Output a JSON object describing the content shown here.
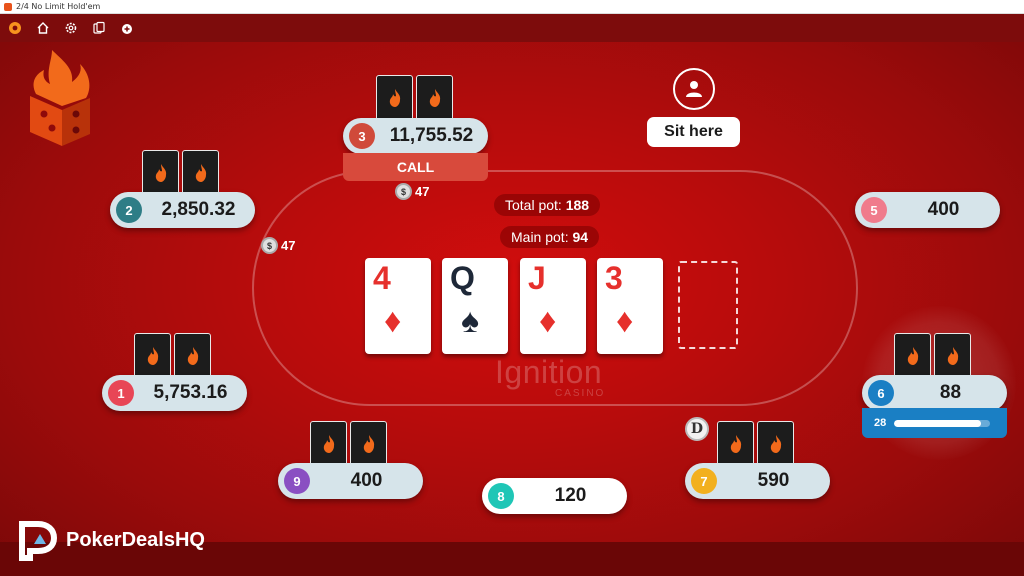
{
  "window": {
    "title": "2/4 No Limit Hold'em"
  },
  "toolbar": {
    "buttons": [
      {
        "icon": "lobby-logo-icon"
      },
      {
        "icon": "home-icon"
      },
      {
        "icon": "gear-icon"
      },
      {
        "icon": "cards-icon"
      },
      {
        "icon": "add-chips-icon"
      }
    ]
  },
  "seats": {
    "s1": {
      "number": "1",
      "stack": "5,753.16",
      "color": "#e84656"
    },
    "s2": {
      "number": "2",
      "stack": "2,850.32",
      "color": "#2e7d86"
    },
    "s3": {
      "number": "3",
      "stack": "11,755.52",
      "color": "#d04a3a",
      "action": "CALL"
    },
    "s5": {
      "number": "5",
      "stack": "400",
      "color": "#f07b8c"
    },
    "s6": {
      "number": "6",
      "stack": "88",
      "color": "#1a7fc4",
      "timer_seconds": "28",
      "timer_fraction": 0.9
    },
    "s7": {
      "number": "7",
      "stack": "590",
      "color": "#f2b01e"
    },
    "s8": {
      "number": "8",
      "stack": "120",
      "color": "#1fc6b6"
    },
    "s9": {
      "number": "9",
      "stack": "400",
      "color": "#8a4fc2"
    }
  },
  "bets": {
    "seat3": "47",
    "seat2": "47"
  },
  "pot": {
    "total_label": "Total pot:",
    "total_value": "188",
    "main_label": "Main pot:",
    "main_value": "94"
  },
  "board": [
    {
      "rank": "4",
      "suit": "♦",
      "color": "red"
    },
    {
      "rank": "Q",
      "suit": "♠",
      "color": "black"
    },
    {
      "rank": "J",
      "suit": "♦",
      "color": "red"
    },
    {
      "rank": "3",
      "suit": "♦",
      "color": "red"
    }
  ],
  "branding": {
    "casino": "Ignition",
    "casino_sub": "CASINO"
  },
  "open_seat": {
    "label": "Sit here"
  },
  "dealer_button": "D",
  "watermark": {
    "text": "PokerDealsHQ"
  }
}
